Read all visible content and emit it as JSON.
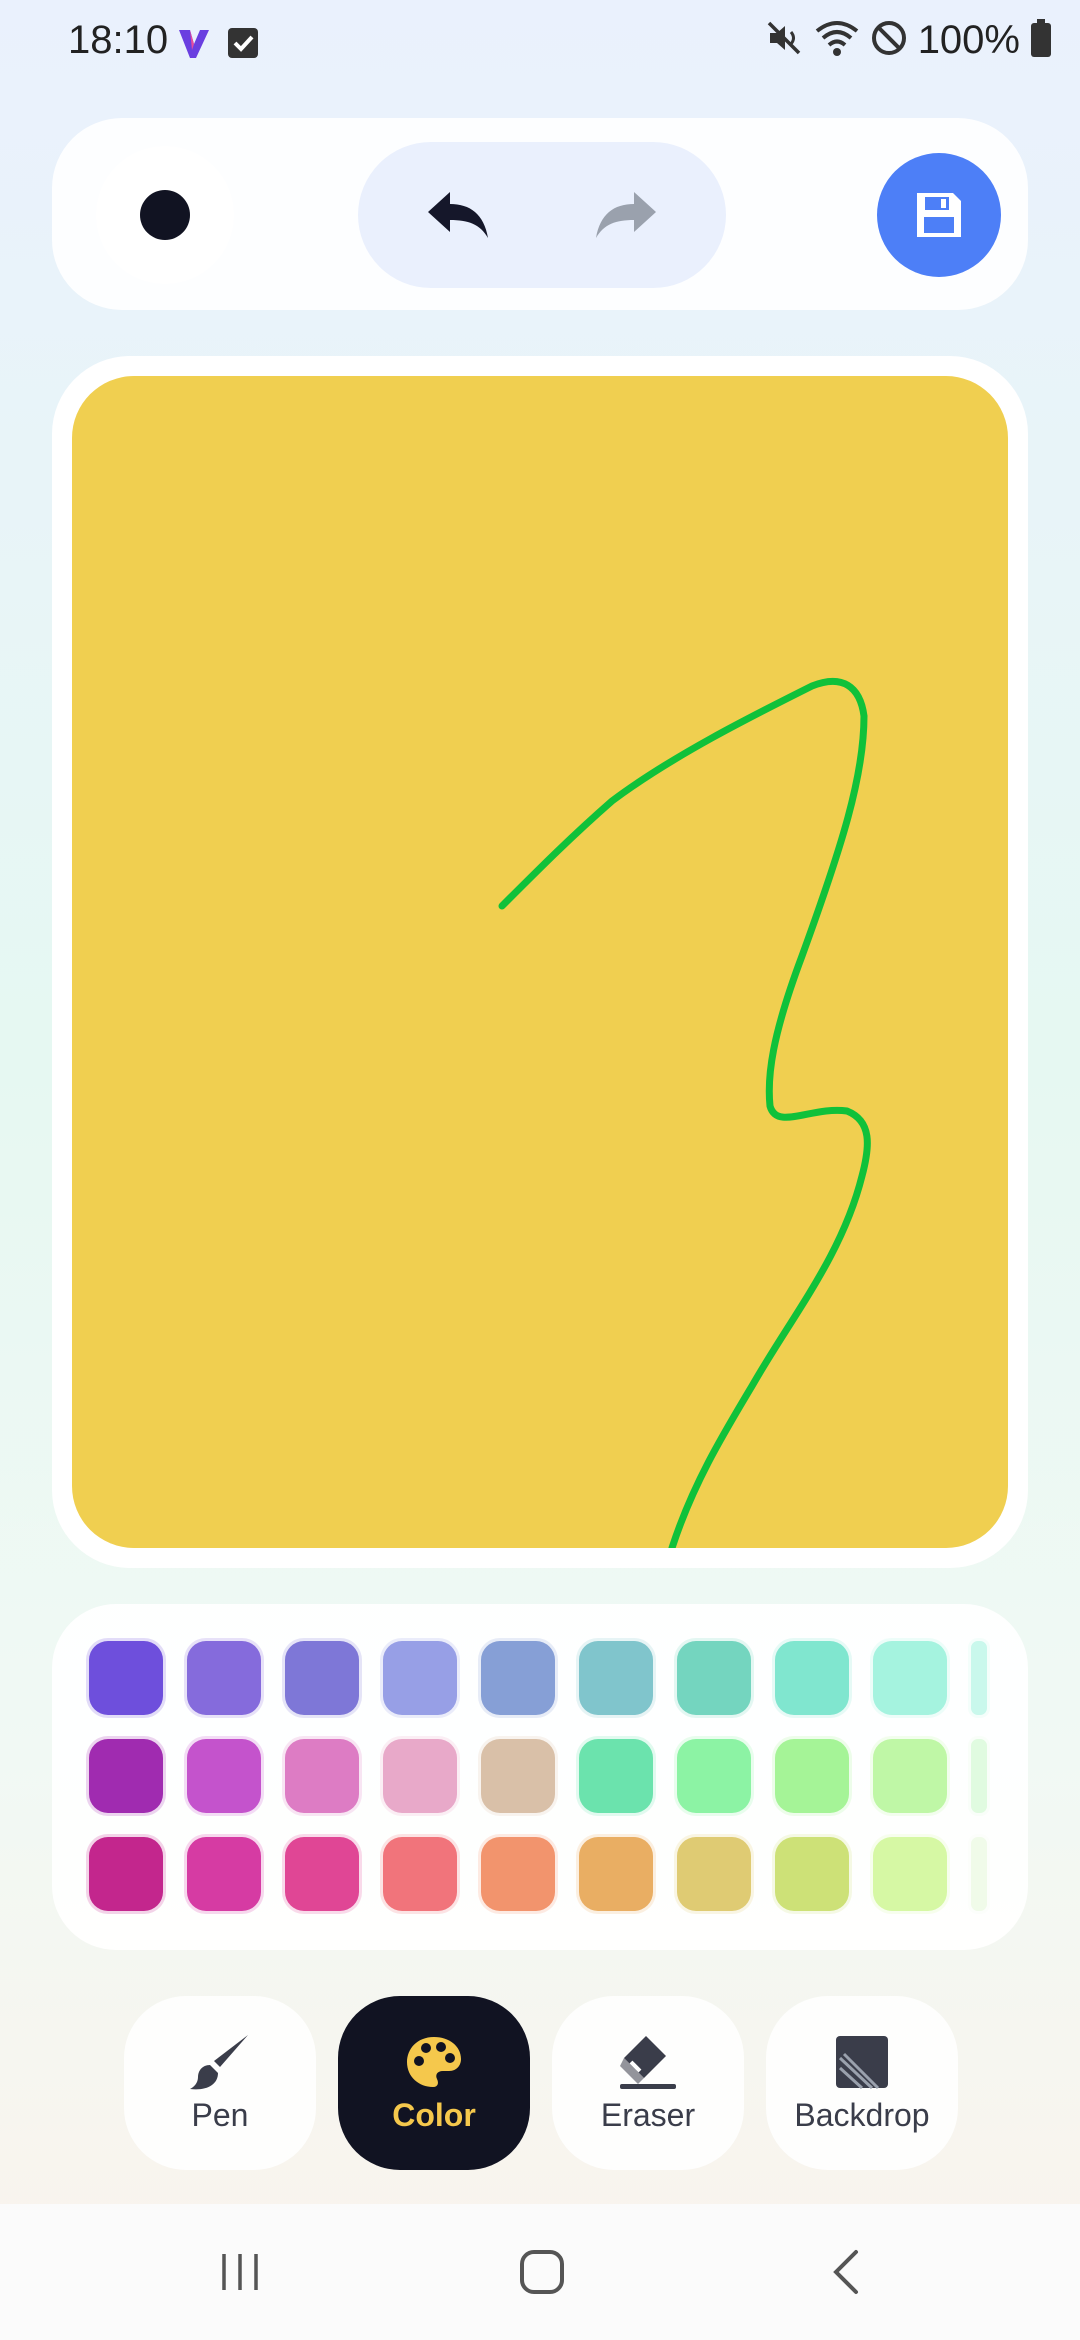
{
  "status_bar": {
    "time": "18:10",
    "battery": "100%",
    "icons": [
      "app-v-icon",
      "check-box-icon",
      "mute-icon",
      "wifi-icon",
      "dnd-icon",
      "battery-icon"
    ]
  },
  "toolbar": {
    "brush_color": "#111322",
    "undo_icon": "undo-icon",
    "redo_icon": "redo-icon",
    "save_icon": "floppy-save-icon",
    "accent": "#4d7ff7"
  },
  "canvas": {
    "background": "#f0cf50",
    "stroke_color": "#10c13a"
  },
  "palette": {
    "rows": [
      [
        "#6e4fdc",
        "#856bdc",
        "#7e77d7",
        "#979fe6",
        "#869fd6",
        "#80c5cc",
        "#74d5bf",
        "#80e6cf",
        "#a5f3df",
        "#c9f8ec"
      ],
      [
        "#a02bb0",
        "#c453cc",
        "#dd7cc4",
        "#e8a9c9",
        "#d9c0a8",
        "#6be3ad",
        "#8cf3a4",
        "#a5f497",
        "#bff7a6",
        "#e0fbe0"
      ],
      [
        "#c3268d",
        "#d63ba3",
        "#e04695",
        "#f1747b",
        "#f2946d",
        "#e9ae63",
        "#dfcb73",
        "#cde177",
        "#d6f8a4",
        "#f0fbe9"
      ]
    ]
  },
  "modes": [
    {
      "label": "Pen",
      "icon": "brush-icon",
      "active": false
    },
    {
      "label": "Color",
      "icon": "palette-icon",
      "active": true
    },
    {
      "label": "Eraser",
      "icon": "eraser-icon",
      "active": false
    },
    {
      "label": "Backdrop",
      "icon": "backdrop-icon",
      "active": false
    }
  ],
  "nav": {
    "recents_icon": "recents-icon",
    "home_icon": "home-icon",
    "back_icon": "back-icon"
  }
}
